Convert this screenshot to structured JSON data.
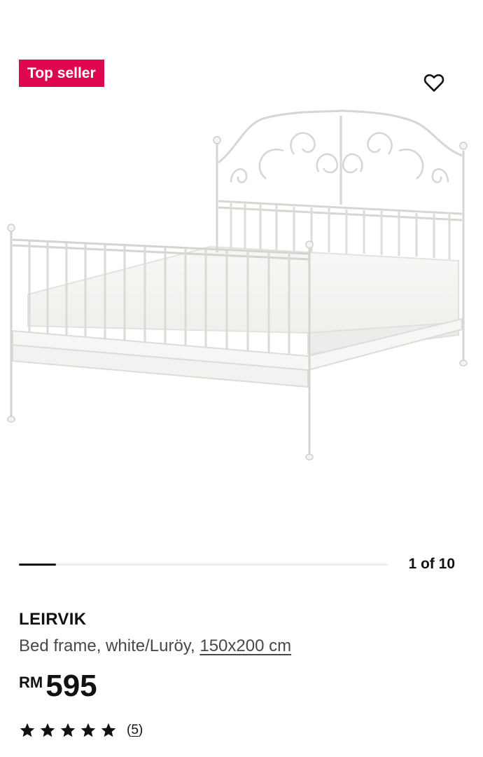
{
  "badge": {
    "label": "Top seller",
    "color": "#e00751"
  },
  "favourite": {
    "icon": "heart-icon"
  },
  "gallery": {
    "image_subject": "bed-frame-image",
    "counter_text": "1 of 10",
    "current": 1,
    "total": 10,
    "progress_fraction": 0.1
  },
  "product": {
    "name": "LEIRVIK",
    "description": "Bed frame, white/Luröy,",
    "size_link": "150x200 cm",
    "price_currency": "RM",
    "price_amount": "595",
    "rating_stars": 5,
    "review_open": "(",
    "review_count": "5",
    "review_close": ")"
  }
}
